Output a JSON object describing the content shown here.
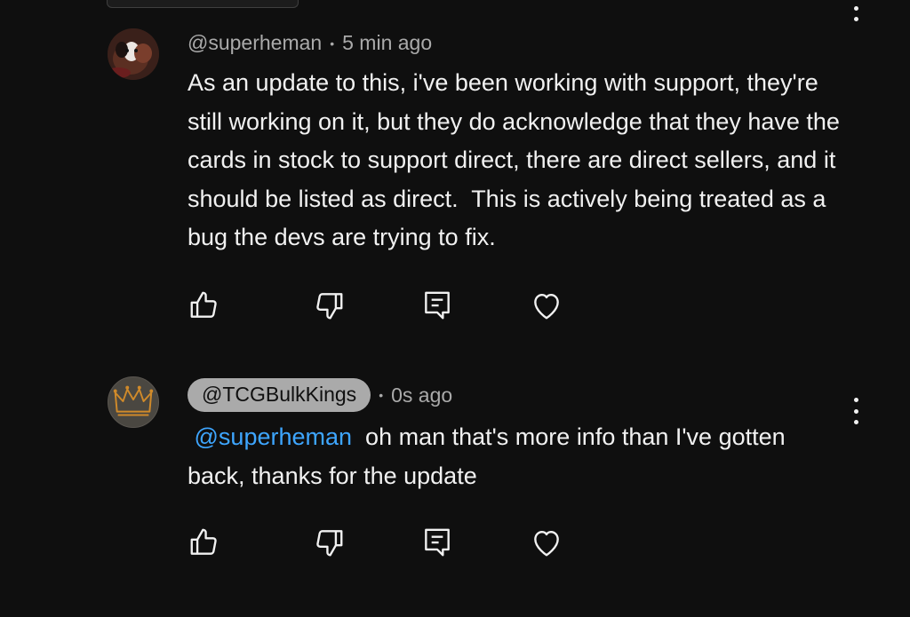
{
  "comments": [
    {
      "author": "@superheman",
      "time": "5 min ago",
      "separator": "•",
      "text": "As an update to this, i've been working with support, they're still working on it, but they do acknowledge that they have the cards in stock to support direct, there are direct sellers, and it should be listed as direct.  This is actively being treated as a bug the devs are trying to fix.",
      "actions": [
        "thumbs-up-icon",
        "thumbs-down-icon",
        "reply-icon",
        "heart-icon"
      ]
    },
    {
      "author": "@TCGBulkKings",
      "time": "0s ago",
      "separator": "•",
      "mention": "@superheman",
      "text": "oh man that's more info than I've gotten back, thanks for the update",
      "actions": [
        "thumbs-up-icon",
        "thumbs-down-icon",
        "reply-icon",
        "heart-icon"
      ]
    }
  ],
  "colors": {
    "background": "#0f0f0f",
    "text": "#f1f1f1",
    "muted": "#aaaaaa",
    "mention": "#3ea6ff"
  }
}
